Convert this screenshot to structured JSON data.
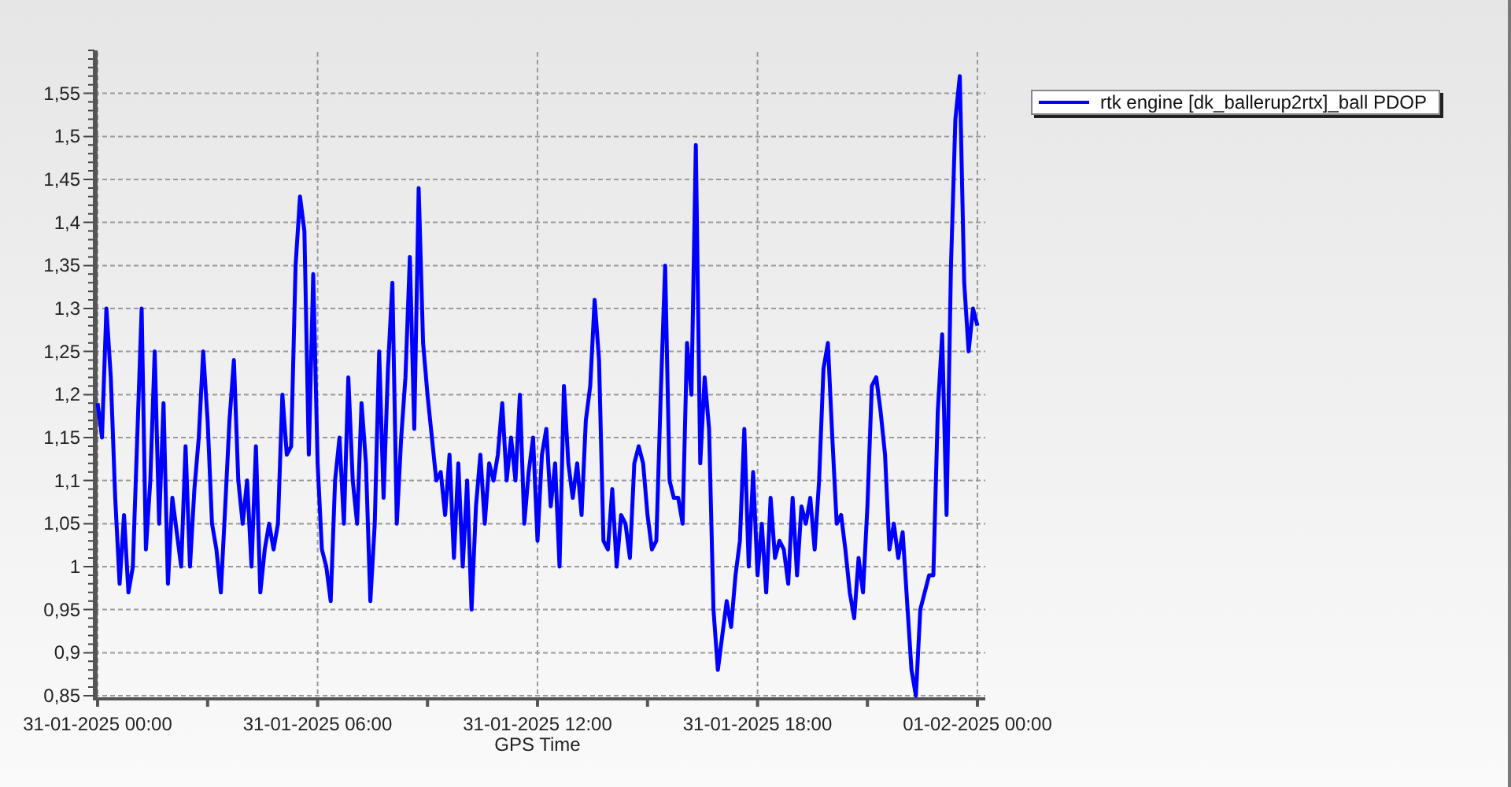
{
  "chart_data": {
    "type": "line",
    "xlabel": "GPS Time",
    "grid": true,
    "ylim": [
      0.85,
      1.6
    ],
    "categories": [
      "31-01-2025 00:00",
      null,
      null,
      null,
      null,
      null,
      null,
      null,
      null,
      null,
      null,
      null,
      null,
      null,
      null,
      null,
      null,
      null,
      null,
      null,
      null,
      null,
      null,
      null,
      null,
      null,
      null,
      null,
      null,
      null,
      null,
      null,
      null,
      null,
      null,
      null,
      null,
      null,
      null,
      null,
      null,
      null,
      null,
      null,
      null,
      null,
      null,
      null,
      null,
      null,
      "31-01-2025 06:00",
      null,
      null,
      null,
      null,
      null,
      null,
      null,
      null,
      null,
      null,
      null,
      null,
      null,
      null,
      null,
      null,
      null,
      null,
      null,
      null,
      null,
      null,
      null,
      null,
      null,
      null,
      null,
      null,
      null,
      null,
      null,
      null,
      null,
      null,
      null,
      null,
      null,
      null,
      null,
      null,
      null,
      null,
      null,
      null,
      null,
      null,
      null,
      null,
      null,
      "31-01-2025 12:00",
      null,
      null,
      null,
      null,
      null,
      null,
      null,
      null,
      null,
      null,
      null,
      null,
      null,
      null,
      null,
      null,
      null,
      null,
      null,
      null,
      null,
      null,
      null,
      null,
      null,
      null,
      null,
      null,
      null,
      null,
      null,
      null,
      null,
      null,
      null,
      null,
      null,
      null,
      null,
      null,
      null,
      null,
      null,
      null,
      null,
      null,
      null,
      null,
      null,
      "31-01-2025 18:00",
      null,
      null,
      null,
      null,
      null,
      null,
      null,
      null,
      null,
      null,
      null,
      null,
      null,
      null,
      null,
      null,
      null,
      null,
      null,
      null,
      null,
      null,
      null,
      null,
      null,
      null,
      null,
      null,
      null,
      null,
      null,
      null,
      null,
      null,
      null,
      null,
      null,
      null,
      null,
      null,
      null,
      null,
      null,
      null,
      null,
      null,
      null,
      null,
      null,
      "01-02-2025 00:00"
    ],
    "yticks": [
      {
        "value": 0.85,
        "label": "0,85"
      },
      {
        "value": 0.9,
        "label": "0,9"
      },
      {
        "value": 0.95,
        "label": "0,95"
      },
      {
        "value": 1,
        "label": "1"
      },
      {
        "value": 1.05,
        "label": "1,05"
      },
      {
        "value": 1.1,
        "label": "1,1"
      },
      {
        "value": 1.15,
        "label": "1,15"
      },
      {
        "value": 1.2,
        "label": "1,2"
      },
      {
        "value": 1.25,
        "label": "1,25"
      },
      {
        "value": 1.3,
        "label": "1,3"
      },
      {
        "value": 1.35,
        "label": "1,35"
      },
      {
        "value": 1.4,
        "label": "1,4"
      },
      {
        "value": 1.45,
        "label": "1,45"
      },
      {
        "value": 1.5,
        "label": "1,5"
      },
      {
        "value": 1.55,
        "label": "1,55"
      }
    ],
    "series": [
      {
        "name": "rtk engine [dk_ballerup2rtx]_ball PDOP",
        "color": "#0000ff",
        "values": [
          1.19,
          1.15,
          1.3,
          1.22,
          1.08,
          0.98,
          1.06,
          0.97,
          1.0,
          1.15,
          1.3,
          1.02,
          1.1,
          1.25,
          1.05,
          1.19,
          0.98,
          1.08,
          1.04,
          1.0,
          1.14,
          1.0,
          1.09,
          1.15,
          1.25,
          1.17,
          1.05,
          1.02,
          0.97,
          1.07,
          1.17,
          1.24,
          1.1,
          1.05,
          1.1,
          1.0,
          1.14,
          0.97,
          1.02,
          1.05,
          1.02,
          1.05,
          1.2,
          1.13,
          1.14,
          1.35,
          1.43,
          1.39,
          1.13,
          1.34,
          1.12,
          1.02,
          1.0,
          0.96,
          1.1,
          1.15,
          1.05,
          1.22,
          1.1,
          1.05,
          1.19,
          1.12,
          0.96,
          1.05,
          1.25,
          1.08,
          1.23,
          1.33,
          1.05,
          1.15,
          1.22,
          1.36,
          1.16,
          1.44,
          1.26,
          1.2,
          1.15,
          1.1,
          1.11,
          1.06,
          1.13,
          1.01,
          1.12,
          1.0,
          1.1,
          0.95,
          1.07,
          1.13,
          1.05,
          1.12,
          1.1,
          1.13,
          1.19,
          1.1,
          1.15,
          1.1,
          1.2,
          1.05,
          1.11,
          1.15,
          1.03,
          1.13,
          1.16,
          1.07,
          1.12,
          1.0,
          1.21,
          1.12,
          1.08,
          1.12,
          1.06,
          1.17,
          1.21,
          1.31,
          1.24,
          1.03,
          1.02,
          1.09,
          1.0,
          1.06,
          1.05,
          1.01,
          1.12,
          1.14,
          1.12,
          1.06,
          1.02,
          1.03,
          1.2,
          1.35,
          1.1,
          1.08,
          1.08,
          1.05,
          1.26,
          1.2,
          1.49,
          1.12,
          1.22,
          1.16,
          0.95,
          0.88,
          0.92,
          0.96,
          0.93,
          0.99,
          1.03,
          1.16,
          1.0,
          1.11,
          0.99,
          1.05,
          0.97,
          1.08,
          1.01,
          1.03,
          1.02,
          0.98,
          1.08,
          0.99,
          1.07,
          1.05,
          1.08,
          1.02,
          1.1,
          1.23,
          1.26,
          1.15,
          1.05,
          1.06,
          1.02,
          0.97,
          0.94,
          1.01,
          0.97,
          1.07,
          1.21,
          1.22,
          1.18,
          1.13,
          1.02,
          1.05,
          1.01,
          1.04,
          0.96,
          0.88,
          0.85,
          0.95,
          0.97,
          0.99,
          0.99,
          1.18,
          1.27,
          1.06,
          1.35,
          1.52,
          1.57,
          1.33,
          1.25,
          1.3,
          1.28
        ]
      }
    ]
  }
}
